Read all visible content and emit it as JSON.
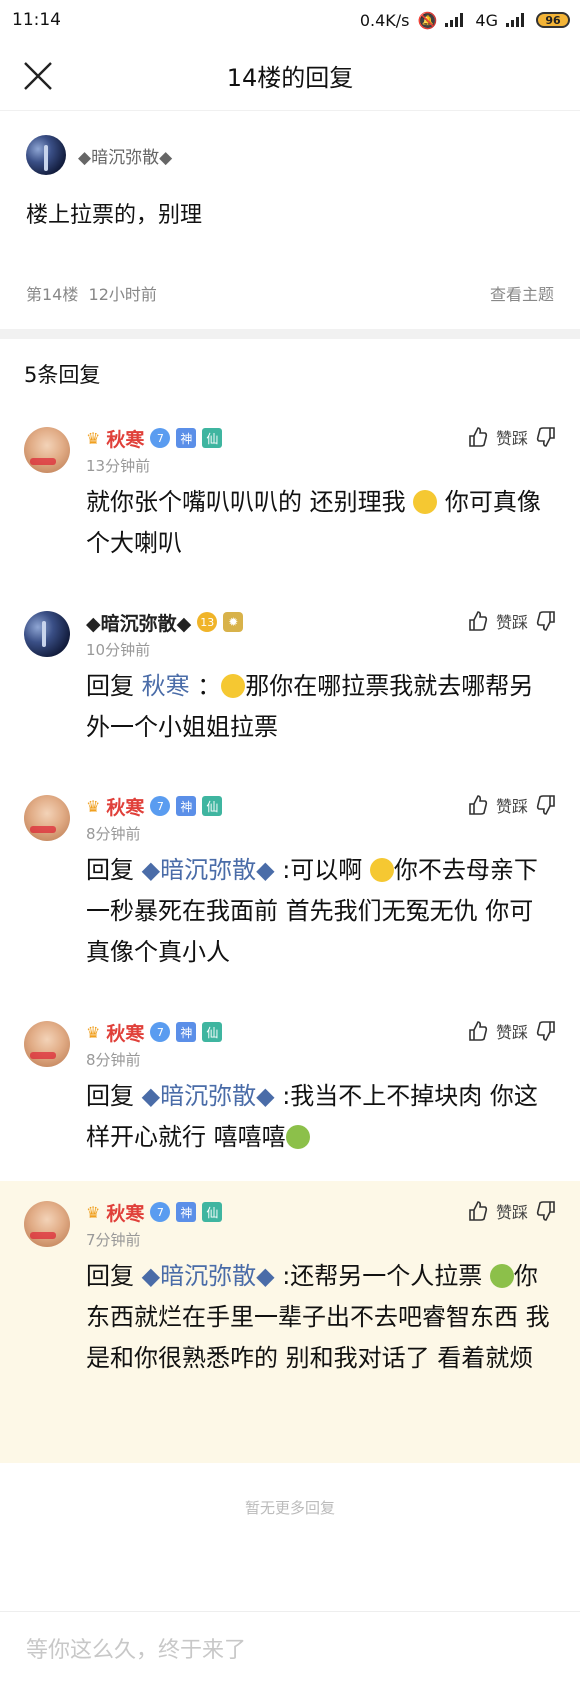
{
  "status": {
    "time": "11:14",
    "speed": "0.4K/s",
    "network": "4G",
    "battery": "96"
  },
  "header": {
    "title": "14楼的回复"
  },
  "op": {
    "username": "◆暗沉弥散◆",
    "content": "楼上拉票的，别理",
    "floor": "第14楼",
    "time": "12小时前",
    "view_topic": "查看主题"
  },
  "reply_count": "5条回复",
  "vote_label": "赞踩",
  "replies": [
    {
      "name": "秋寒",
      "level": "7",
      "time": "13分钟前",
      "text1": "就你张个嘴叭叭叭的 还别理我 ",
      "text2": " 你可真像个大喇叭"
    },
    {
      "name": "◆暗沉弥散◆",
      "level": "13",
      "time": "10分钟前",
      "reply_prefix": "回复 ",
      "mention": "秋寒",
      "colon": " ：",
      "text": "那你在哪拉票我就去哪帮另外一个小姐姐拉票"
    },
    {
      "name": "秋寒",
      "level": "7",
      "time": "8分钟前",
      "reply_prefix": "回复 ",
      "mention": "◆暗沉弥散◆",
      "colon": " :可以啊 ",
      "text": "你不去母亲下一秒暴死在我面前 首先我们无冤无仇 你可真像个真小人"
    },
    {
      "name": "秋寒",
      "level": "7",
      "time": "8分钟前",
      "reply_prefix": "回复 ",
      "mention": "◆暗沉弥散◆",
      "colon": " :",
      "text": "我当不上不掉块肉 你这样开心就行 嘻嘻嘻"
    },
    {
      "name": "秋寒",
      "level": "7",
      "time": "7分钟前",
      "reply_prefix": "回复 ",
      "mention": "◆暗沉弥散◆",
      "colon": " :",
      "text1": "还帮另一个人拉票 ",
      "text2": "你东西就烂在手里一辈子出不去吧睿智东西 我是和你很熟悉咋的 别和我对话了 看着就烦"
    }
  ],
  "badges": {
    "tag_shen": "神",
    "tag_xian": "仙"
  },
  "no_more": "暂无更多回复",
  "input_placeholder": "等你这么久，终于来了"
}
